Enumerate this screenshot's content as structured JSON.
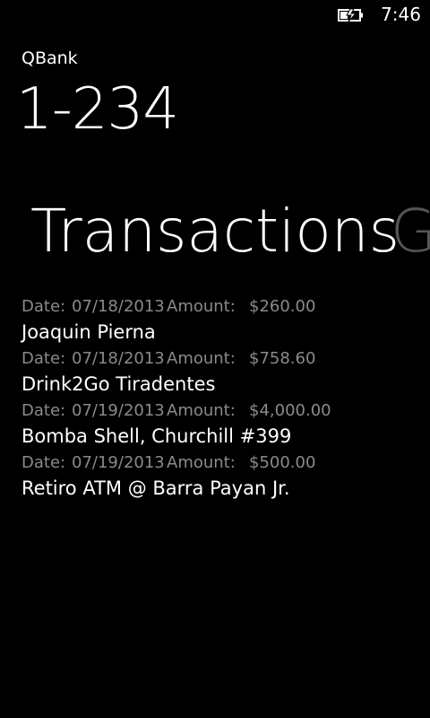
{
  "status_bar": {
    "time": "7:46",
    "battery_icon": "battery-charging-icon"
  },
  "app": {
    "name": "QBank",
    "account": "1-234"
  },
  "pivot": {
    "current": "Transactions",
    "next_glyph": "G"
  },
  "labels": {
    "date": "Date:",
    "amount": "Amount:"
  },
  "transactions": [
    {
      "date": "07/18/2013",
      "amount": "$260.00",
      "payee": "Joaquin Pierna"
    },
    {
      "date": "07/18/2013",
      "amount": "$758.60",
      "payee": "Drink2Go Tiradentes"
    },
    {
      "date": "07/19/2013",
      "amount": "$4,000.00",
      "payee": "Bomba Shell, Churchill #399"
    },
    {
      "date": "07/19/2013",
      "amount": "$500.00",
      "payee": "Retiro ATM @ Barra Payan Jr."
    }
  ],
  "colors": {
    "background": "#000000",
    "foreground": "#ffffff",
    "subtle": "#8a8a8a",
    "next_pivot": "#555555"
  }
}
